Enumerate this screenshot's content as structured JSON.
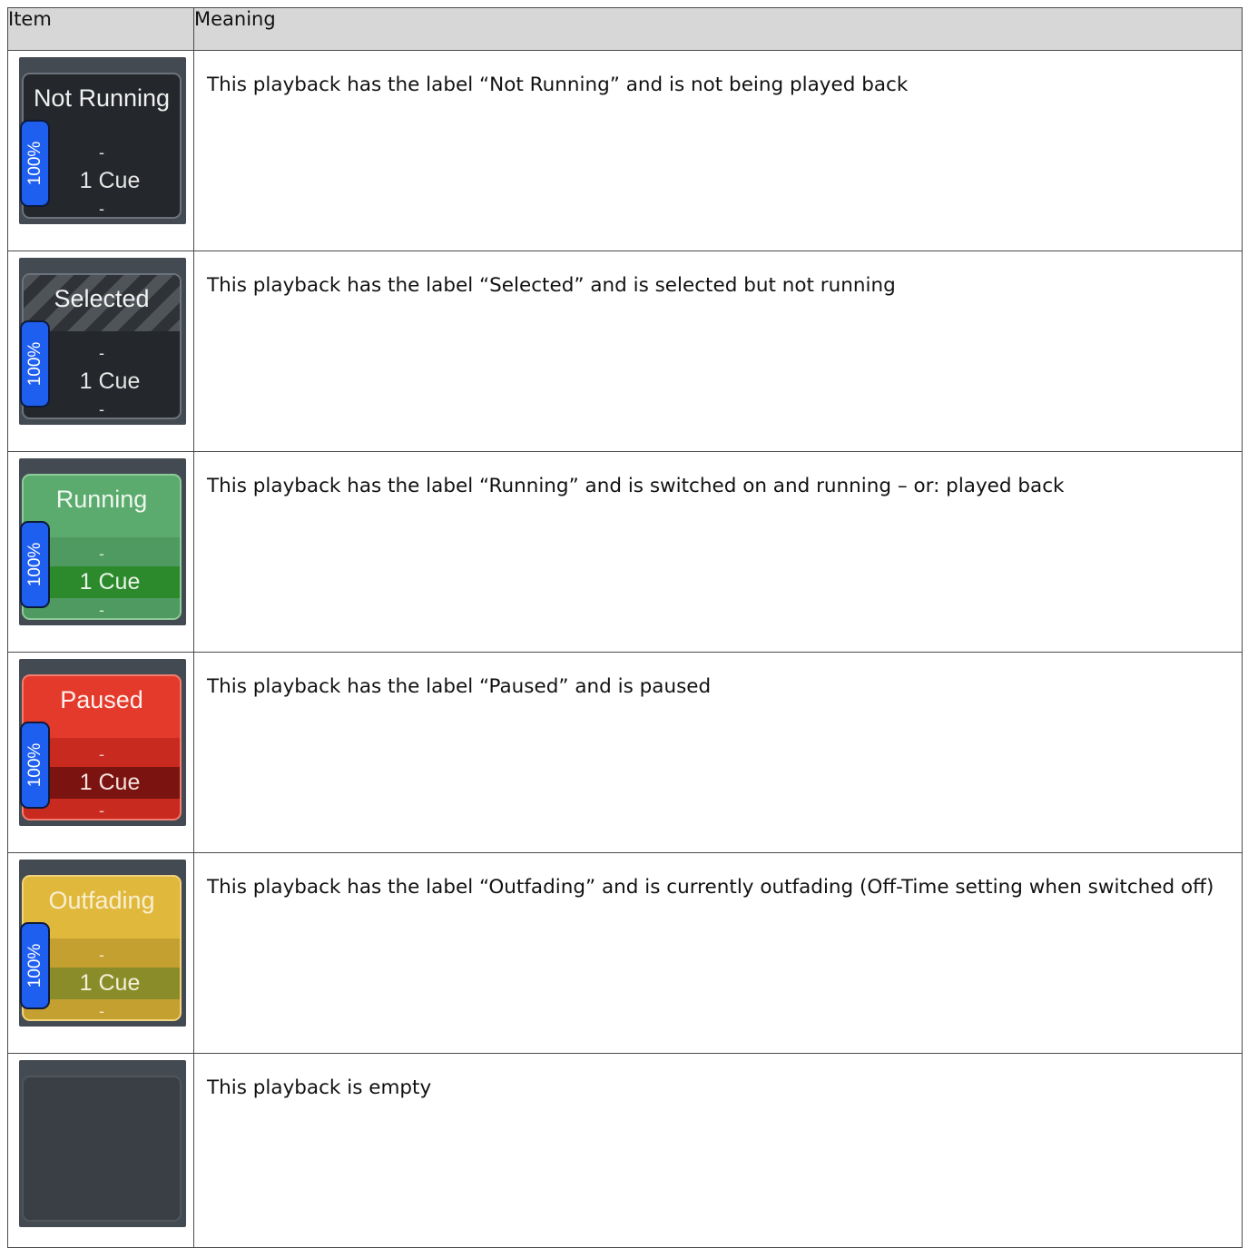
{
  "header": {
    "item": "Item",
    "meaning": "Meaning"
  },
  "rows": [
    {
      "tile_label": "Not Running",
      "fader": "100%",
      "cue": "1 Cue",
      "dash_top": "-",
      "dash_bottom": "-",
      "meaning": "This playback has the label “Not Running” and is not being played back"
    },
    {
      "tile_label": "Selected",
      "fader": "100%",
      "cue": "1 Cue",
      "dash_top": "-",
      "dash_bottom": "-",
      "meaning": "This playback has the label “Selected” and is selected but not running"
    },
    {
      "tile_label": "Running",
      "fader": "100%",
      "cue": "1 Cue",
      "dash_top": "-",
      "dash_bottom": "-",
      "meaning": "This playback has the label “Running” and is switched on and running – or: played back"
    },
    {
      "tile_label": "Paused",
      "fader": "100%",
      "cue": "1 Cue",
      "dash_top": "-",
      "dash_bottom": "-",
      "meaning": "This playback has the label “Paused” and is paused"
    },
    {
      "tile_label": "Outfading",
      "fader": "100%",
      "cue": "1 Cue",
      "dash_top": "-",
      "dash_bottom": "-",
      "meaning": "This playback has the label “Outfading” and is currently outfading (Off-Time setting when switched off)"
    },
    {
      "meaning": "This playback is empty"
    }
  ],
  "colors": {
    "running": "#5cab6e",
    "paused": "#e43a2c",
    "outfading": "#e0b83c",
    "fader": "#1f5ff0",
    "tile_dark": "#24272b"
  }
}
